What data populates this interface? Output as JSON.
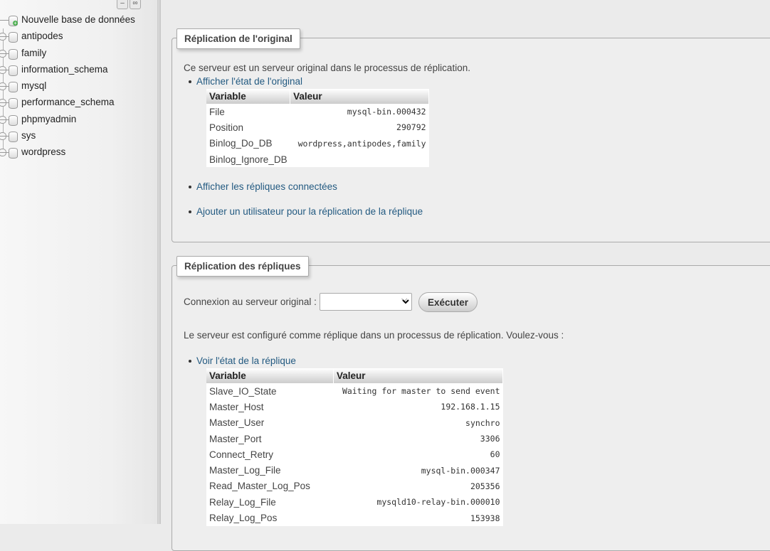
{
  "nav": {
    "new_db": "Nouvelle base de données",
    "databases": [
      "antipodes",
      "family",
      "information_schema",
      "mysql",
      "performance_schema",
      "phpmyadmin",
      "sys",
      "wordpress"
    ]
  },
  "original": {
    "legend": "Réplication de l'original",
    "intro": "Ce serveur est un serveur original dans le processus de réplication.",
    "show_status_link": "Afficher l'état de l'original",
    "table": {
      "headers": [
        "Variable",
        "Valeur"
      ],
      "rows": [
        {
          "variable": "File",
          "value": "mysql-bin.000432"
        },
        {
          "variable": "Position",
          "value": "290792"
        },
        {
          "variable": "Binlog_Do_DB",
          "value": "wordpress,antipodes,family"
        },
        {
          "variable": "Binlog_Ignore_DB",
          "value": ""
        }
      ]
    },
    "show_replicas_link": "Afficher les répliques connectées",
    "add_user_link": "Ajouter un utilisateur pour la réplication de la réplique"
  },
  "replica": {
    "legend": "Réplication des répliques",
    "connection_label": "Connexion au serveur original :",
    "connection_value": "",
    "execute_button": "Exécuter",
    "intro": "Le serveur est configuré comme réplique dans un processus de réplication. Voulez-vous :",
    "show_status_link": "Voir l'état de la réplique",
    "table": {
      "headers": [
        "Variable",
        "Valeur"
      ],
      "rows": [
        {
          "variable": "Slave_IO_State",
          "value": "Waiting for master to send event"
        },
        {
          "variable": "Master_Host",
          "value": "192.168.1.15"
        },
        {
          "variable": "Master_User",
          "value": "synchro"
        },
        {
          "variable": "Master_Port",
          "value": "3306"
        },
        {
          "variable": "Connect_Retry",
          "value": "60"
        },
        {
          "variable": "Master_Log_File",
          "value": "mysql-bin.000347"
        },
        {
          "variable": "Read_Master_Log_Pos",
          "value": "205356"
        },
        {
          "variable": "Relay_Log_File",
          "value": "mysqld10-relay-bin.000010"
        },
        {
          "variable": "Relay_Log_Pos",
          "value": "153938"
        }
      ]
    }
  }
}
